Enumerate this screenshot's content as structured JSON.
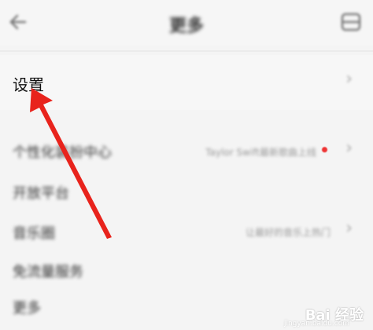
{
  "header": {
    "title": "更多",
    "back_icon": "arrow-left-icon",
    "menu_icon": "window-icon"
  },
  "settings": {
    "label": "设置",
    "chevron": "›"
  },
  "rows": [
    {
      "label": "个性化装扮中心",
      "value": "Taylor Swift最新歌曲上线",
      "chevron": "›",
      "has_dot": true
    },
    {
      "label": "开放平台",
      "value": "",
      "chevron": "",
      "has_dot": false
    },
    {
      "label": "音乐圈",
      "value": "让最好的音乐上热门",
      "chevron": "›",
      "has_dot": false
    },
    {
      "label": "免流量服务",
      "value": "",
      "chevron": "",
      "has_dot": false
    },
    {
      "label": "更多",
      "value": "",
      "chevron": "",
      "has_dot": false
    }
  ],
  "annotation": {
    "color": "#e8231c"
  },
  "watermark": {
    "text": "Bai 经验",
    "sub": "jingyan.baidu.com"
  }
}
